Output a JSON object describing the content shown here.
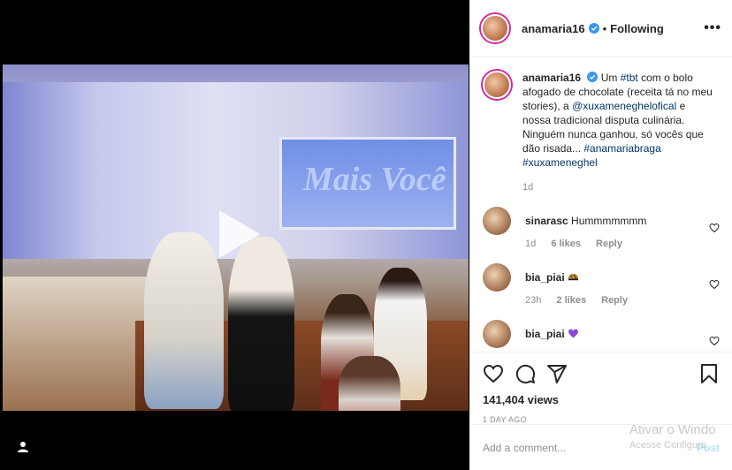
{
  "post": {
    "username": "anamaria16",
    "follow_state": "Following",
    "dot": "•",
    "more": "•••",
    "caption": {
      "username": "anamaria16",
      "parts": [
        {
          "text": "Um ",
          "tag": false
        },
        {
          "text": "#tbt",
          "tag": true
        },
        {
          "text": " com o bolo afogado de chocolate (receita tá no meu stories), a ",
          "tag": false
        },
        {
          "text": "@xuxameneghelofical",
          "tag": true
        },
        {
          "text": " e nossa tradicional disputa culinária. Ninguém nunca ganhou, só vocês que dão risada... ",
          "tag": false
        },
        {
          "text": "#anamariabraga",
          "tag": true
        },
        {
          "text": " ",
          "tag": false
        },
        {
          "text": "#xuxameneghel",
          "tag": true
        }
      ],
      "time": "1d"
    },
    "comments": [
      {
        "username": "sinarasc",
        "text": "Hummmmmmm",
        "emoji": "",
        "time": "1d",
        "likes": "6 likes",
        "reply": "Reply"
      },
      {
        "username": "bia_piai",
        "text": "",
        "emoji": "cookie-emoji",
        "time": "23h",
        "likes": "2 likes",
        "reply": "Reply"
      },
      {
        "username": "bia_piai",
        "text": "",
        "emoji": "purple-heart-emoji",
        "time": "",
        "likes": "",
        "reply": ""
      }
    ],
    "views": "141,404 views",
    "date": "1 DAY AGO",
    "add_comment_placeholder": "Add a comment...",
    "post_label": "Post"
  },
  "video": {
    "logo_text": "Mais Você"
  },
  "watermark": {
    "line1": "Ativar o Windo",
    "line2": "Acesse Configura"
  },
  "colors": {
    "accent": "#0095f6",
    "link": "#00376b",
    "story_ring": "#d6249f",
    "purple_heart": "#8a49d6"
  },
  "icons": [
    "play-icon",
    "user-icon",
    "verified-badge-icon",
    "more-options-icon",
    "heart-icon",
    "comment-icon",
    "share-icon",
    "bookmark-icon"
  ]
}
